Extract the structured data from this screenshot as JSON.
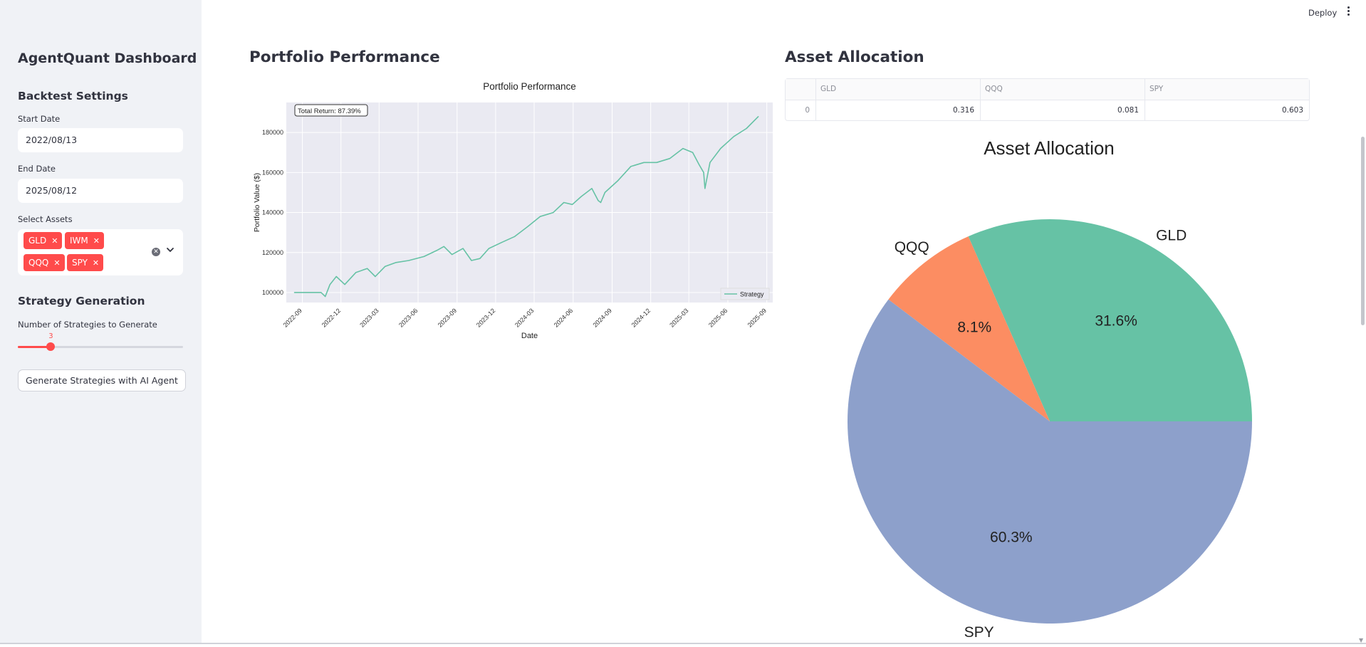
{
  "sidebar": {
    "title": "AgentQuant Dashboard",
    "backtest_heading": "Backtest Settings",
    "start_date_label": "Start Date",
    "start_date_value": "2022/08/13",
    "end_date_label": "End Date",
    "end_date_value": "2025/08/12",
    "assets_label": "Select Assets",
    "assets": [
      "GLD",
      "IWM",
      "QQQ",
      "SPY"
    ],
    "strategy_heading": "Strategy Generation",
    "num_strategies_label": "Number of Strategies to Generate",
    "num_strategies_value": "3",
    "num_strategies_fraction": 0.2,
    "generate_button": "Generate Strategies with AI Agent"
  },
  "header": {
    "deploy_label": "Deploy"
  },
  "main": {
    "performance_heading": "Portfolio Performance",
    "allocation_heading": "Asset Allocation"
  },
  "allocation_table": {
    "columns": [
      "",
      "GLD",
      "QQQ",
      "SPY"
    ],
    "rows": [
      [
        "0",
        "0.316",
        "0.081",
        "0.603"
      ]
    ]
  },
  "colors": {
    "accent": "#ff4b4b",
    "sidebar_bg": "#f0f2f6",
    "line": "#66c2a5",
    "pie_gld": "#66c2a5",
    "pie_qqq": "#fc8d62",
    "pie_spy": "#8da0cb",
    "plot_bg": "#eaeaf2"
  },
  "chart_data": [
    {
      "type": "line",
      "title": "Portfolio Performance",
      "xlabel": "Date",
      "ylabel": "Portfolio Value ($)",
      "annotation": "Total Return: 87.39%",
      "legend": "Strategy",
      "legend_position": "bottom-right",
      "grid": true,
      "x_ticks": [
        "2022-09",
        "2022-12",
        "2023-03",
        "2023-06",
        "2023-09",
        "2023-12",
        "2024-03",
        "2024-06",
        "2024-09",
        "2024-12",
        "2025-03",
        "2025-06",
        "2025-09"
      ],
      "y_ticks": [
        100000,
        120000,
        140000,
        160000,
        180000
      ],
      "ylim": [
        95000,
        195000
      ],
      "series": [
        {
          "name": "Strategy",
          "x": [
            "2022-08-13",
            "2022-10-15",
            "2022-10-25",
            "2022-11-05",
            "2022-11-20",
            "2022-12-10",
            "2023-01-05",
            "2023-02-01",
            "2023-02-20",
            "2023-03-15",
            "2023-04-10",
            "2023-05-10",
            "2023-06-15",
            "2023-07-15",
            "2023-08-01",
            "2023-08-20",
            "2023-09-15",
            "2023-10-05",
            "2023-10-25",
            "2023-11-15",
            "2023-12-15",
            "2024-01-15",
            "2024-02-15",
            "2024-03-15",
            "2024-04-15",
            "2024-05-10",
            "2024-05-30",
            "2024-06-20",
            "2024-07-15",
            "2024-07-30",
            "2024-08-05",
            "2024-08-15",
            "2024-09-15",
            "2024-10-15",
            "2024-11-15",
            "2024-12-15",
            "2025-01-15",
            "2025-02-15",
            "2025-03-10",
            "2025-03-25",
            "2025-04-05",
            "2025-04-08",
            "2025-04-20",
            "2025-05-15",
            "2025-06-15",
            "2025-07-15",
            "2025-08-12"
          ],
          "values": [
            100000,
            100000,
            98000,
            104000,
            108000,
            104000,
            110000,
            112000,
            108000,
            113000,
            115000,
            116000,
            118000,
            121000,
            123000,
            119000,
            122000,
            116000,
            117000,
            122000,
            125000,
            128000,
            133000,
            138000,
            140000,
            145000,
            144000,
            148000,
            152000,
            146000,
            145000,
            150000,
            156000,
            163000,
            165000,
            165000,
            167000,
            172000,
            170000,
            164000,
            160000,
            152000,
            165000,
            172000,
            178000,
            182000,
            188000
          ]
        }
      ]
    },
    {
      "type": "pie",
      "title": "Asset Allocation",
      "categories": [
        "GLD",
        "QQQ",
        "SPY"
      ],
      "values": [
        31.6,
        8.1,
        60.3
      ],
      "labels": [
        "31.6%",
        "8.1%",
        "60.3%"
      ]
    }
  ]
}
